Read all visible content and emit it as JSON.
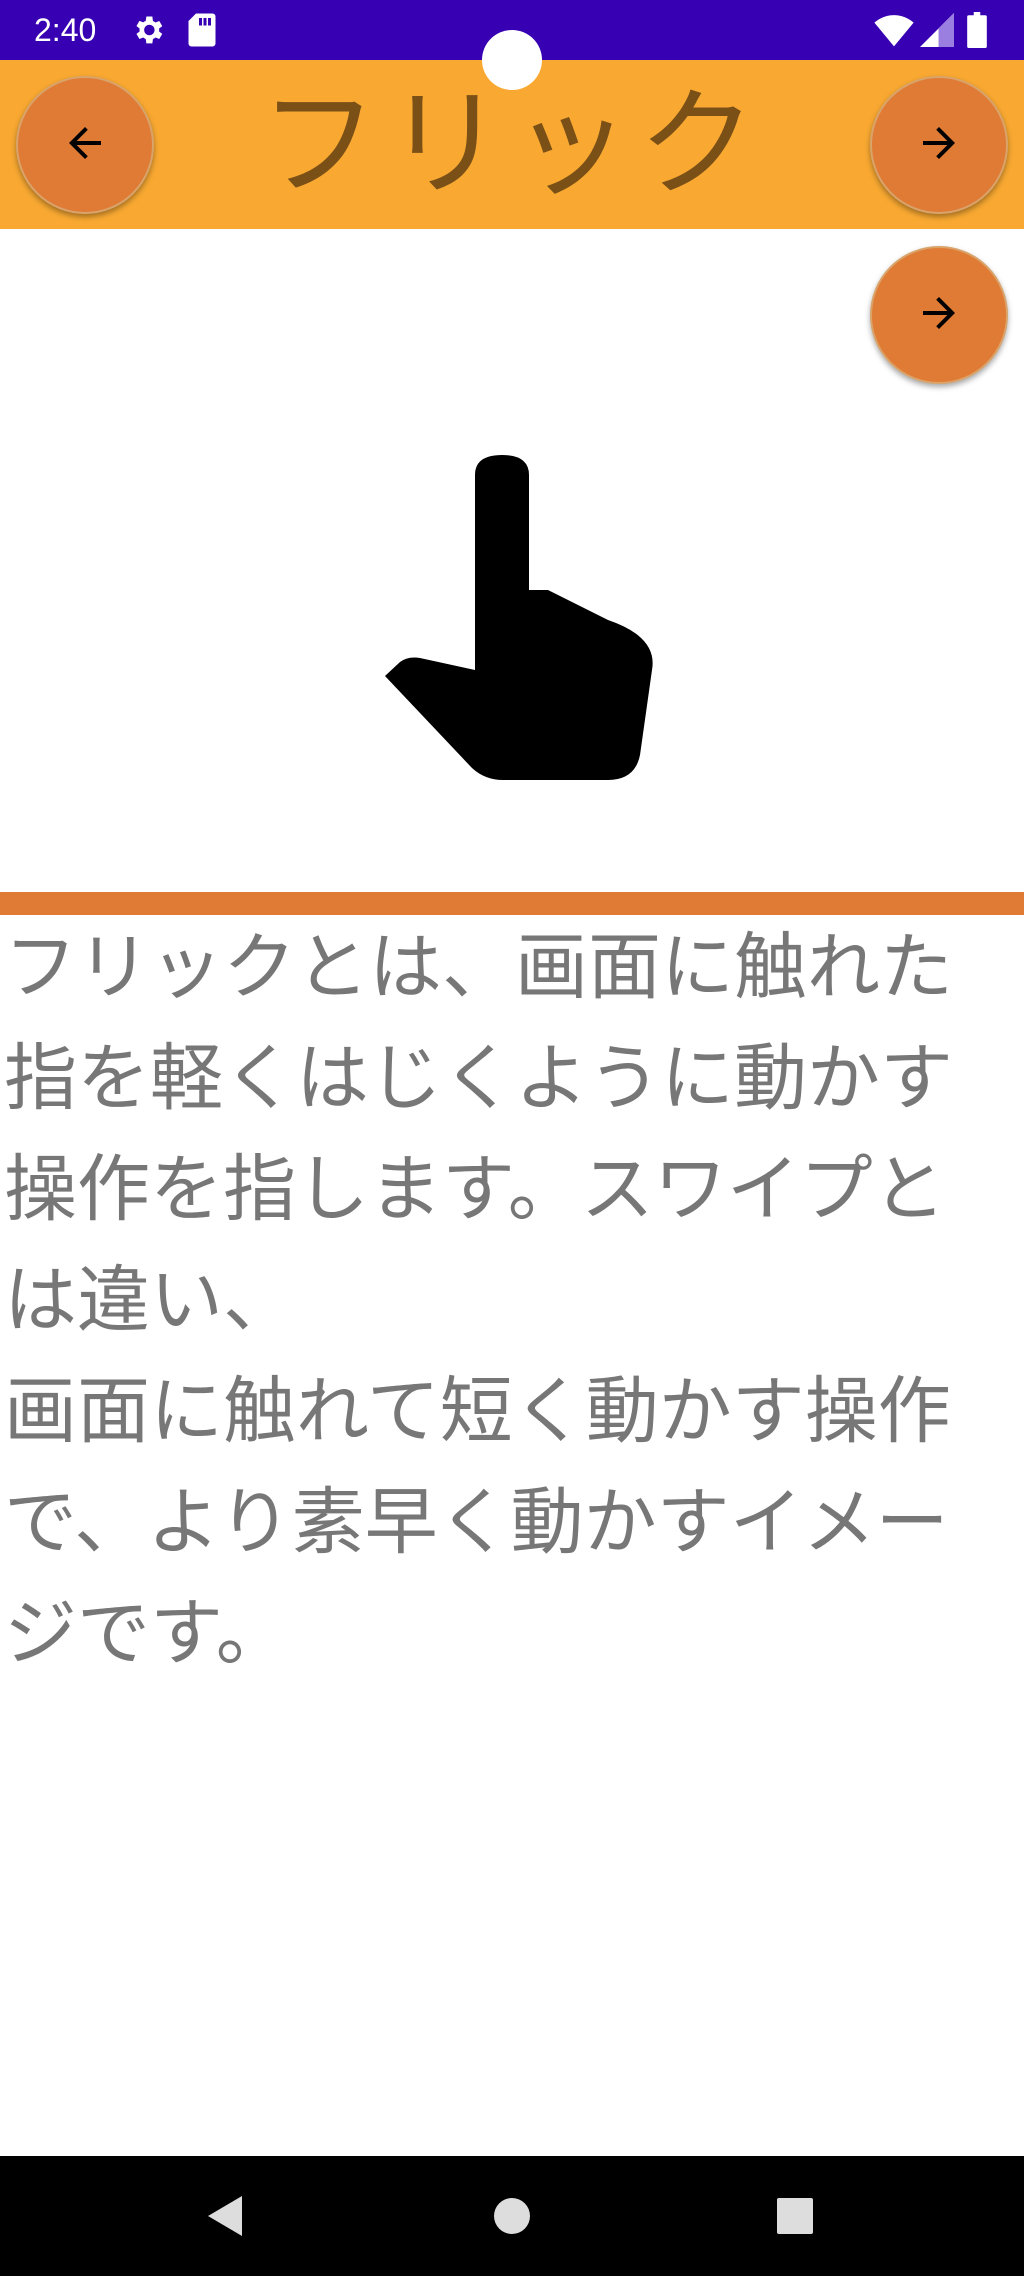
{
  "status_bar": {
    "time": "2:40",
    "icons": [
      "gear-icon",
      "sd-card-icon",
      "wifi-icon",
      "signal-icon",
      "battery-icon"
    ],
    "color": "#3700b3"
  },
  "app_bar": {
    "title": "フリック",
    "background": "#f9a932",
    "title_color": "#7a5016",
    "back_icon": "arrow-left-icon",
    "next_icon": "arrow-right-icon"
  },
  "main": {
    "illustration": "hand-pointer-icon",
    "accent": "#e07b35",
    "description": "フリックとは、画面に触れた指を軽くはじくように動かす操作を指します。スワイプとは違い、\n画面に触れて短く動かす操作で、より素早く動かすイメージです。",
    "next_icon": "arrow-right-icon"
  },
  "nav_bar": {
    "buttons": [
      "back-triangle-icon",
      "home-circle-icon",
      "recents-square-icon"
    ]
  }
}
